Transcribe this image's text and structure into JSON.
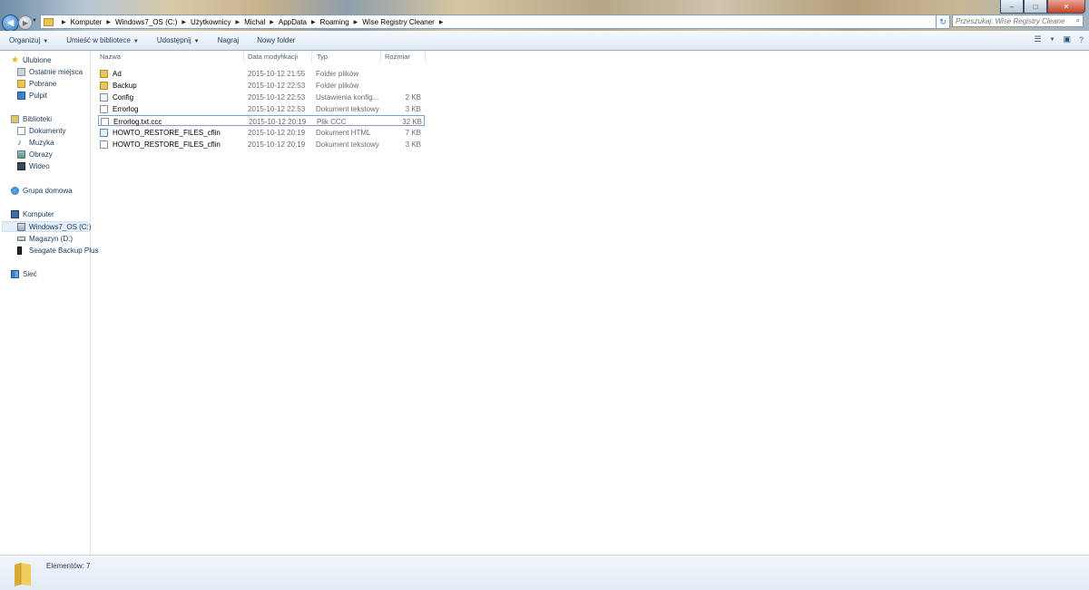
{
  "window": {
    "buttons": {
      "minimize": "–",
      "maximize": "□",
      "close": "✕"
    }
  },
  "address_bar": {
    "crumbs": [
      "Komputer",
      "Windows7_OS (C:)",
      "Użytkownicy",
      "Michal",
      "AppData",
      "Roaming",
      "Wise Registry Cleaner"
    ],
    "search_placeholder": "Przeszukaj: Wise Registry Cleaner"
  },
  "toolbar": {
    "organize": "Organizuj",
    "include_library": "Umieść w bibliotece",
    "share": "Udostępnij",
    "burn": "Nagraj",
    "new_folder": "Nowy folder"
  },
  "sidebar": {
    "favorites": {
      "label": "Ulubione",
      "items": [
        "Ostatnie miejsca",
        "Pobrane",
        "Pulpit"
      ]
    },
    "libraries": {
      "label": "Biblioteki",
      "items": [
        "Dokumenty",
        "Muzyka",
        "Obrazy",
        "Wideo"
      ]
    },
    "homegroup": "Grupa domowa",
    "computer": {
      "label": "Komputer",
      "items": [
        "Windows7_OS (C:)",
        "Magazyn (D:)",
        "Seagate Backup Plus"
      ]
    },
    "network": "Sieć"
  },
  "columns": {
    "name": "Nazwa",
    "date": "Data modyfikacji",
    "type": "Typ",
    "size": "Rozmiar"
  },
  "files": [
    {
      "name": "Ad",
      "date": "2015-10-12 21:55",
      "type": "Folder plików",
      "size": "",
      "icon": "folder-icon"
    },
    {
      "name": "Backup",
      "date": "2015-10-12 22:53",
      "type": "Folder plików",
      "size": "",
      "icon": "folder-icon"
    },
    {
      "name": "Config",
      "date": "2015-10-12 22:53",
      "type": "Ustawienia konfig...",
      "size": "2 KB",
      "icon": "config-file-icon"
    },
    {
      "name": "Errorlog",
      "date": "2015-10-12 22:53",
      "type": "Dokument tekstowy",
      "size": "3 KB",
      "icon": "text-file-icon"
    },
    {
      "name": "Errorlog.txt.ccc",
      "date": "2015-10-12 20:19",
      "type": "Plik CCC",
      "size": "32 KB",
      "icon": "blank-file-icon"
    },
    {
      "name": "HOWTO_RESTORE_FILES_cflin",
      "date": "2015-10-12 20:19",
      "type": "Dokument HTML",
      "size": "7 KB",
      "icon": "html-file-icon"
    },
    {
      "name": "HOWTO_RESTORE_FILES_cflin",
      "date": "2015-10-12 20:19",
      "type": "Dokument tekstowy",
      "size": "3 KB",
      "icon": "text-file-icon"
    }
  ],
  "status_bar": {
    "count": "Elementów: 7"
  }
}
